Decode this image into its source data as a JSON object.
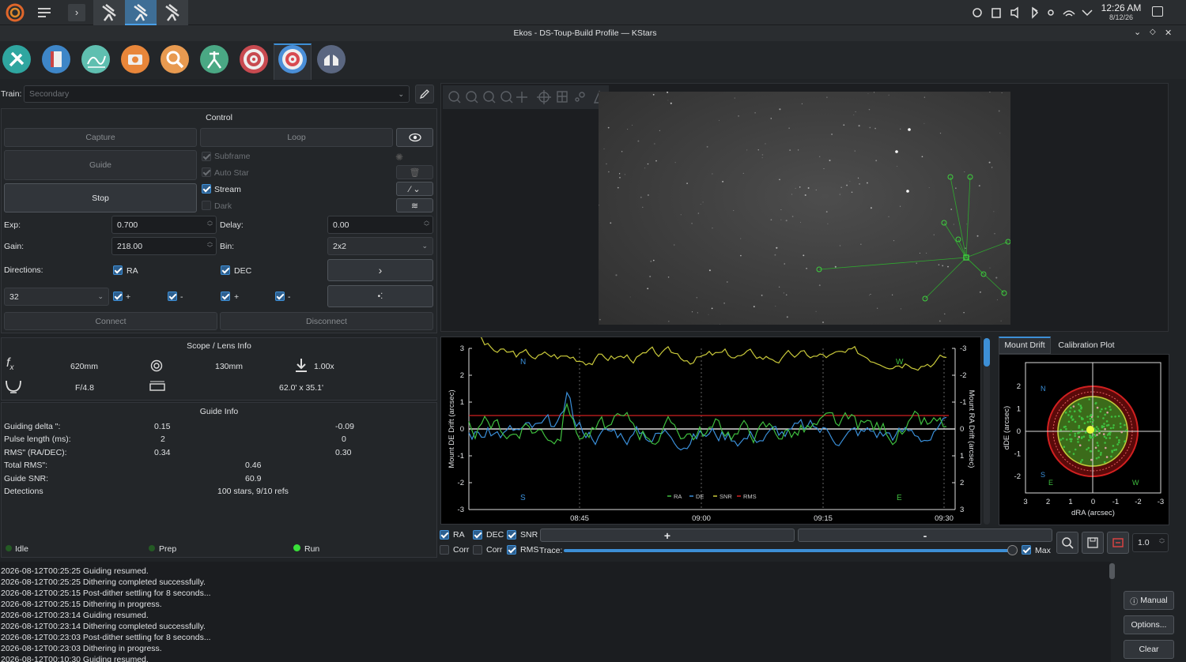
{
  "taskbar": {
    "clock_time": "12:26 AM",
    "clock_date": "8/12/26"
  },
  "window": {
    "title": "Ekos - DS-Toup-Build Profile — KStars"
  },
  "toolbar": {
    "icons": [
      "setup-icon",
      "scheduler-icon",
      "analyze-icon",
      "capture-icon",
      "focus-icon",
      "mount-icon",
      "align-icon",
      "guide-icon",
      "observatory-icon"
    ],
    "active": "guide-icon"
  },
  "train": {
    "label": "Train:",
    "value": "Secondary"
  },
  "control": {
    "title": "Control",
    "capture": "Capture",
    "loop": "Loop",
    "guide": "Guide",
    "stop": "Stop",
    "subframe": "Subframe",
    "auto_star": "Auto Star",
    "stream": "Stream",
    "dark": "Dark",
    "exp_label": "Exp:",
    "exp_value": "0.700",
    "delay_label": "Delay:",
    "delay_value": "0.00",
    "gain_label": "Gain:",
    "gain_value": "218.00",
    "bin_label": "Bin:",
    "bin_value": "2x2",
    "directions_label": "Directions:",
    "ra": "RA",
    "dec": "DEC",
    "box_size": "32",
    "plus1": "+",
    "minus1": "-",
    "plus2": "+",
    "minus2": "-",
    "connect": "Connect",
    "disconnect": "Disconnect"
  },
  "scope": {
    "title": "Scope / Lens Info",
    "focal_length": "620mm",
    "aperture": "130mm",
    "reducer": "1.00x",
    "focal_ratio": "F/4.8",
    "fov": "62.0' x 35.1'"
  },
  "guide_info": {
    "title": "Guide Info",
    "rows": [
      {
        "label": "Guiding delta \":",
        "ra": "0.15",
        "dec": "-0.09"
      },
      {
        "label": "Pulse length (ms):",
        "ra": "2",
        "dec": "0"
      },
      {
        "label": "RMS\" (RA/DEC):",
        "ra": "0.34",
        "dec": "0.30"
      }
    ],
    "total_rms_label": "Total RMS\":",
    "total_rms": "0.46",
    "snr_label": "Guide SNR:",
    "snr": "60.9",
    "detections_label": "Detections",
    "detections": "100 stars, 9/10 refs"
  },
  "status": {
    "idle": "Idle",
    "prep": "Prep",
    "run": "Run"
  },
  "graph": {
    "left_axis_label": "Mount DE Drift (arcsec)",
    "right_axis_label": "Mount RA Drift (arcsec)",
    "compass_n": "N",
    "compass_w": "W",
    "compass_s": "S",
    "compass_e": "E",
    "legend": [
      "RA",
      "DE",
      "SNR",
      "RMS"
    ],
    "x_ticks": [
      "08:45",
      "09:00",
      "09:15",
      "09:30"
    ],
    "left_ticks": [
      "3",
      "2",
      "1",
      "0",
      "-1",
      "-2",
      "-3"
    ],
    "right_ticks": [
      "-3",
      "-2",
      "-1",
      "0",
      "1",
      "2",
      "3"
    ],
    "colors": {
      "ra": "#3a8fd9",
      "de": "#3fbf3f",
      "snr": "#c9c93a",
      "rms": "#d02020"
    }
  },
  "graph_controls": {
    "ra": "RA",
    "dec": "DEC",
    "snr": "SNR",
    "corr1": "Corr",
    "corr2": "Corr",
    "rms": "RMS",
    "plus": "+",
    "minus": "-",
    "trace": "Trace:",
    "max": "Max",
    "zoom_value": "1.0"
  },
  "drift_tabs": {
    "tab1": "Mount Drift",
    "tab2": "Calibration Plot"
  },
  "drift_plot": {
    "ylabel": "dDE (arcsec)",
    "xlabel": "dRA (arcsec)",
    "n": "N",
    "s": "S",
    "e": "E",
    "w": "W",
    "x_ticks": [
      "3",
      "2",
      "1",
      "0",
      "-1",
      "-2",
      "-3"
    ],
    "y_ticks": [
      "2",
      "1",
      "0",
      "-1",
      "-2"
    ]
  },
  "log": {
    "lines": [
      "2026-08-12T00:25:25 Guiding resumed.",
      "2026-08-12T00:25:25 Dithering completed successfully.",
      "2026-08-12T00:25:15 Post-dither settling for 8 seconds...",
      "2026-08-12T00:25:15 Dithering in progress.",
      "2026-08-12T00:23:14 Guiding resumed.",
      "2026-08-12T00:23:14 Dithering completed successfully.",
      "2026-08-12T00:23:03 Post-dither settling for 8 seconds...",
      "2026-08-12T00:23:03 Dithering in progress.",
      "2026-08-12T00:10:30 Guiding resumed."
    ],
    "manual": "Manual",
    "options": "Options...",
    "clear": "Clear"
  }
}
